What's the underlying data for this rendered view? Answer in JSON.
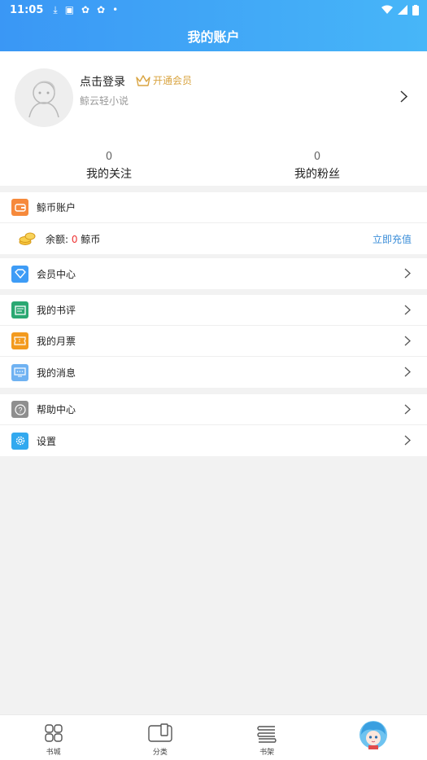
{
  "status_bar": {
    "time": "11:05"
  },
  "header": {
    "title": "我的账户"
  },
  "profile": {
    "login": "点击登录",
    "vip_label": "开通会员",
    "subtitle": "鲸云轻小说",
    "following_count": "0",
    "following_label": "我的关注",
    "fans_count": "0",
    "fans_label": "我的粉丝"
  },
  "wallet": {
    "title": "鲸币账户",
    "balance_prefix": "余额:",
    "balance_value": "0",
    "balance_unit": "鲸币",
    "recharge": "立即充值"
  },
  "menu": {
    "vip_center": "会员中心",
    "book_review": "我的书评",
    "monthly_ticket": "我的月票",
    "messages": "我的消息",
    "help": "帮助中心",
    "settings": "设置"
  },
  "tabbar": {
    "store": "书城",
    "category": "分类",
    "shelf": "书架"
  },
  "colors": {
    "header_start": "#3a97f5",
    "header_end": "#47b6f8",
    "vip_gold": "#d9a441",
    "balance_red": "#e33333",
    "link_blue": "#3a8dd8"
  }
}
